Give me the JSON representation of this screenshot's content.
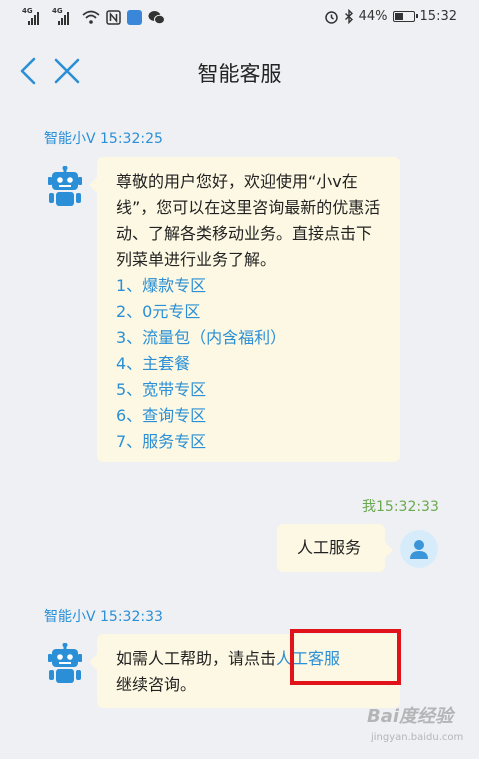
{
  "status_bar": {
    "signal1_label": "4G",
    "signal2_label": "4G",
    "battery_percent": "44%",
    "time": "15:32"
  },
  "header": {
    "title": "智能客服"
  },
  "messages": [
    {
      "sender": "智能小V 15:32:25",
      "intro": "尊敬的用户您好，欢迎使用“小v在线”，您可以在这里咨询最新的优惠活动、了解各类移动业务。直接点击下列菜单进行业务了解。",
      "menu": [
        "1、爆款专区",
        "2、0元专区",
        "3、流量包（内含福利）",
        "4、主套餐",
        "5、宽带专区",
        "6、查询专区",
        "7、服务专区"
      ]
    },
    {
      "sender": "我15:32:33",
      "text": "人工服务"
    },
    {
      "sender": "智能小V 15:32:33",
      "text_before": "如需人工帮助，请点击",
      "link": "人工客服",
      "text_after": "继续咨询。"
    }
  ],
  "watermark": {
    "main": "Bai度经验",
    "sub": "jingyan.baidu.com"
  },
  "colors": {
    "background": "#eef0f4",
    "bubble": "#fcf8e3",
    "accent_blue": "#2a8fd6",
    "my_name_green": "#6aa84f",
    "highlight_red": "#e0121a"
  }
}
